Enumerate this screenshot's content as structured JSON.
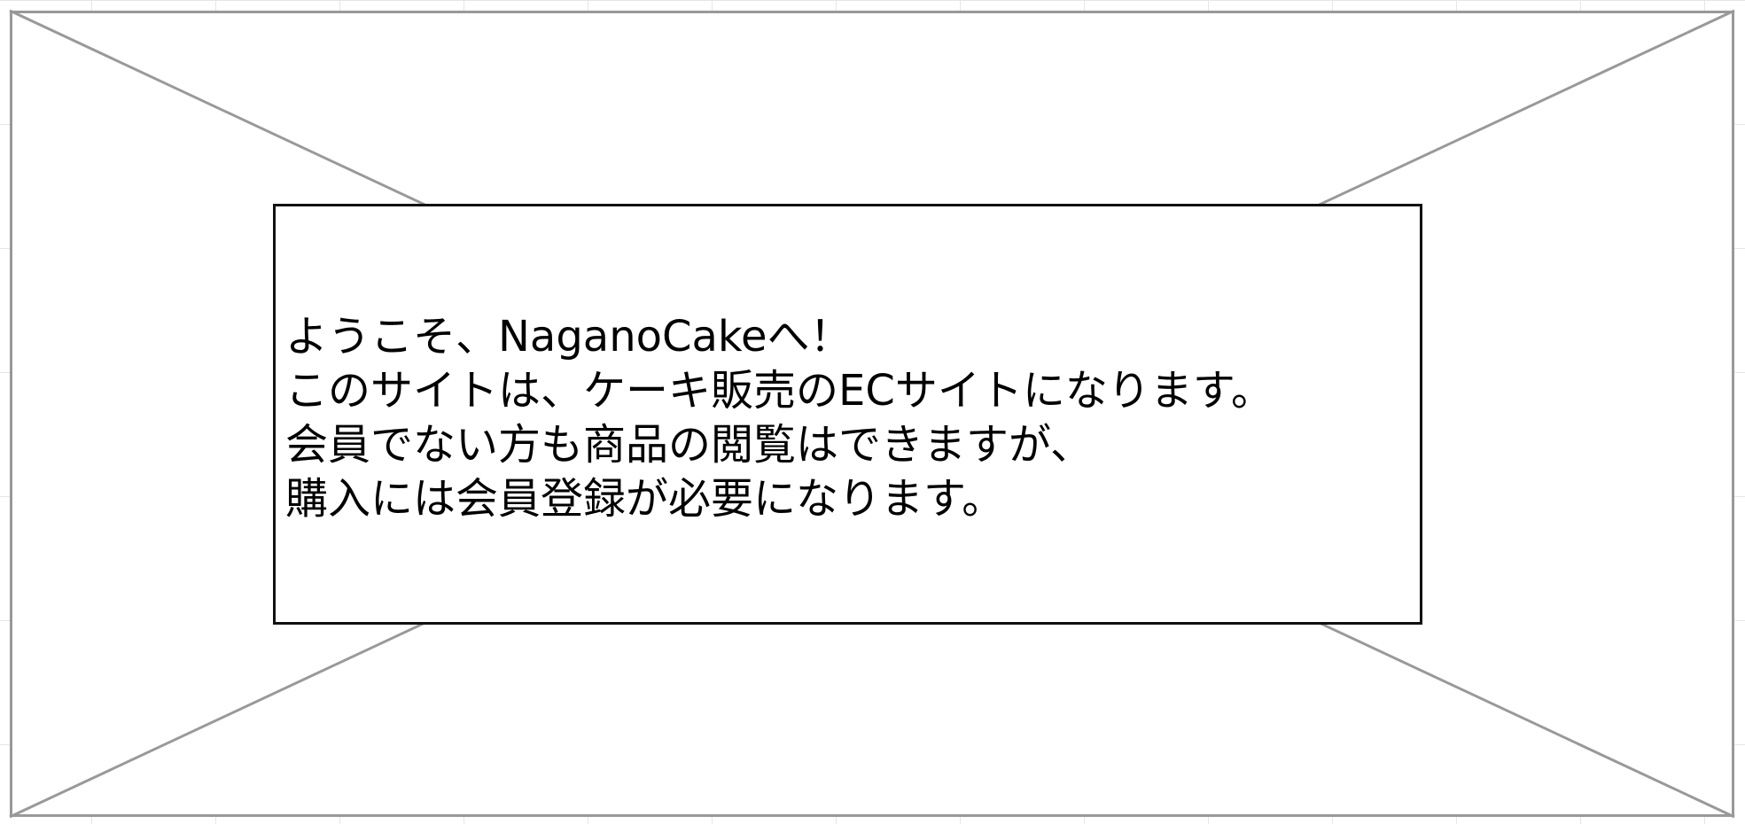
{
  "welcome_box": {
    "lines": [
      "ようこそ、NaganoCakeへ！",
      "このサイトは、ケーキ販売のECサイトになります。",
      "会員でない方も商品の閲覧はできますが、",
      "購入には会員登録が必要になります。"
    ]
  },
  "colors": {
    "placeholder_border": "#999999",
    "box_border": "#111111",
    "text": "#000000",
    "grid": "#e6e6e6"
  }
}
